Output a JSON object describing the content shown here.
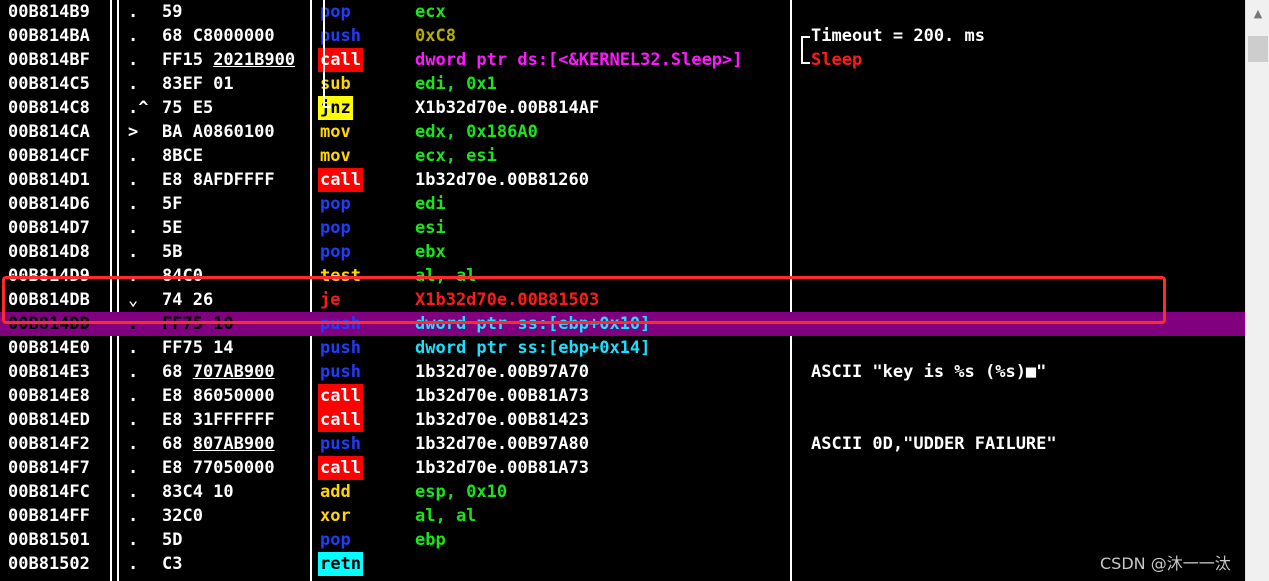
{
  "rows": [
    {
      "addr": "00B814B9",
      "mark": ".",
      "hex": "59",
      "mnemonic": "pop",
      "mn_fg": "c-blue",
      "mn_bg": "",
      "operand": "ecx",
      "op_fg": "c-green",
      "comment": ""
    },
    {
      "addr": "00B814BA",
      "mark": ".",
      "hex": "68 C8000000",
      "mnemonic": "push",
      "mn_fg": "c-blue",
      "mn_bg": "",
      "operand": "0xC8",
      "op_fg": "c-olive",
      "comment": "Timeout = 200. ms"
    },
    {
      "addr": "00B814BF",
      "mark": ".",
      "hex": "FF15 2021B900",
      "mnemonic": "call",
      "mn_fg": "c-white",
      "mn_bg": "bg-red",
      "operand": "dword ptr ds:[<&KERNEL32.Sleep>]",
      "op_fg": "c-magenta",
      "comment": "Sleep"
    },
    {
      "addr": "00B814C5",
      "mark": ".",
      "hex": "83EF 01",
      "mnemonic": "sub",
      "mn_fg": "c-yellow",
      "mn_bg": "",
      "operand": "edi, 0x1",
      "op_fg": "c-green",
      "comment": ""
    },
    {
      "addr": "00B814C8",
      "mark": ".^",
      "hex": "75 E5",
      "mnemonic": "jnz",
      "mn_fg": "c-black",
      "mn_bg": "bg-yellow",
      "operand": "X1b32d70e.00B814AF",
      "op_fg": "c-white",
      "comment": ""
    },
    {
      "addr": "00B814CA",
      "mark": ">",
      "hex": "BA A0860100",
      "mnemonic": "mov",
      "mn_fg": "c-yellow",
      "mn_bg": "",
      "operand": "edx, 0x186A0",
      "op_fg": "c-green",
      "comment": ""
    },
    {
      "addr": "00B814CF",
      "mark": ".",
      "hex": "8BCE",
      "mnemonic": "mov",
      "mn_fg": "c-yellow",
      "mn_bg": "",
      "operand": "ecx, esi",
      "op_fg": "c-green",
      "comment": ""
    },
    {
      "addr": "00B814D1",
      "mark": ".",
      "hex": "E8 8AFDFFFF",
      "mnemonic": "call",
      "mn_fg": "c-white",
      "mn_bg": "bg-red",
      "operand": "1b32d70e.00B81260",
      "op_fg": "c-white",
      "comment": ""
    },
    {
      "addr": "00B814D6",
      "mark": ".",
      "hex": "5F",
      "mnemonic": "pop",
      "mn_fg": "c-blue",
      "mn_bg": "",
      "operand": "edi",
      "op_fg": "c-green",
      "comment": ""
    },
    {
      "addr": "00B814D7",
      "mark": ".",
      "hex": "5E",
      "mnemonic": "pop",
      "mn_fg": "c-blue",
      "mn_bg": "",
      "operand": "esi",
      "op_fg": "c-green",
      "comment": ""
    },
    {
      "addr": "00B814D8",
      "mark": ".",
      "hex": "5B",
      "mnemonic": "pop",
      "mn_fg": "c-blue",
      "mn_bg": "",
      "operand": "ebx",
      "op_fg": "c-green",
      "comment": ""
    },
    {
      "addr": "00B814D9",
      "mark": ".",
      "hex": "84C0",
      "mnemonic": "test",
      "mn_fg": "c-yellow",
      "mn_bg": "",
      "operand": "al, al",
      "op_fg": "c-green",
      "comment": ""
    },
    {
      "addr": "00B814DB",
      "mark": "⌄",
      "hex": "74 26",
      "mnemonic": "je",
      "mn_fg": "c-red",
      "mn_bg": "",
      "operand": "X1b32d70e.00B81503",
      "op_fg": "c-red",
      "comment": ""
    },
    {
      "addr": "00B814DD",
      "mark": ".",
      "hex": "FF75 10",
      "mnemonic": "push",
      "mn_fg": "c-blue",
      "mn_bg": "",
      "operand": "dword ptr ss:[ebp+0x10]",
      "op_fg": "c-cyan",
      "comment": ""
    },
    {
      "addr": "00B814E0",
      "mark": ".",
      "hex": "FF75 14",
      "mnemonic": "push",
      "mn_fg": "c-blue",
      "mn_bg": "",
      "operand": "dword ptr ss:[ebp+0x14]",
      "op_fg": "c-cyan",
      "comment": ""
    },
    {
      "addr": "00B814E3",
      "mark": ".",
      "hex": "68 707AB900",
      "mnemonic": "push",
      "mn_fg": "c-blue",
      "mn_bg": "",
      "operand": "1b32d70e.00B97A70",
      "op_fg": "c-white",
      "comment": "ASCII \"key is %s (%s)■\""
    },
    {
      "addr": "00B814E8",
      "mark": ".",
      "hex": "E8 86050000",
      "mnemonic": "call",
      "mn_fg": "c-white",
      "mn_bg": "bg-red",
      "operand": "1b32d70e.00B81A73",
      "op_fg": "c-white",
      "comment": ""
    },
    {
      "addr": "00B814ED",
      "mark": ".",
      "hex": "E8 31FFFFFF",
      "mnemonic": "call",
      "mn_fg": "c-white",
      "mn_bg": "bg-red",
      "operand": "1b32d70e.00B81423",
      "op_fg": "c-white",
      "comment": ""
    },
    {
      "addr": "00B814F2",
      "mark": ".",
      "hex": "68 807AB900",
      "mnemonic": "push",
      "mn_fg": "c-blue",
      "mn_bg": "",
      "operand": "1b32d70e.00B97A80",
      "op_fg": "c-white",
      "comment": "ASCII 0D,\"UDDER FAILURE\""
    },
    {
      "addr": "00B814F7",
      "mark": ".",
      "hex": "E8 77050000",
      "mnemonic": "call",
      "mn_fg": "c-white",
      "mn_bg": "bg-red",
      "operand": "1b32d70e.00B81A73",
      "op_fg": "c-white",
      "comment": ""
    },
    {
      "addr": "00B814FC",
      "mark": ".",
      "hex": "83C4 10",
      "mnemonic": "add",
      "mn_fg": "c-yellow",
      "mn_bg": "",
      "operand": "esp, 0x10",
      "op_fg": "c-green",
      "comment": ""
    },
    {
      "addr": "00B814FF",
      "mark": ".",
      "hex": "32C0",
      "mnemonic": "xor",
      "mn_fg": "c-yellow",
      "mn_bg": "",
      "operand": "al, al",
      "op_fg": "c-green",
      "comment": ""
    },
    {
      "addr": "00B81501",
      "mark": ".",
      "hex": "5D",
      "mnemonic": "pop",
      "mn_fg": "c-blue",
      "mn_bg": "",
      "operand": "ebp",
      "op_fg": "c-green",
      "comment": ""
    },
    {
      "addr": "00B81502",
      "mark": ".",
      "hex": "C3",
      "mnemonic": "retn",
      "mn_fg": "c-black",
      "mn_bg": "bg-cyan",
      "operand": "",
      "op_fg": "c-white",
      "comment": ""
    }
  ],
  "selected_row_addr": "00B814DD",
  "highlighted_row_addr": "00B814DB",
  "watermark": "CSDN @沐一一汰"
}
